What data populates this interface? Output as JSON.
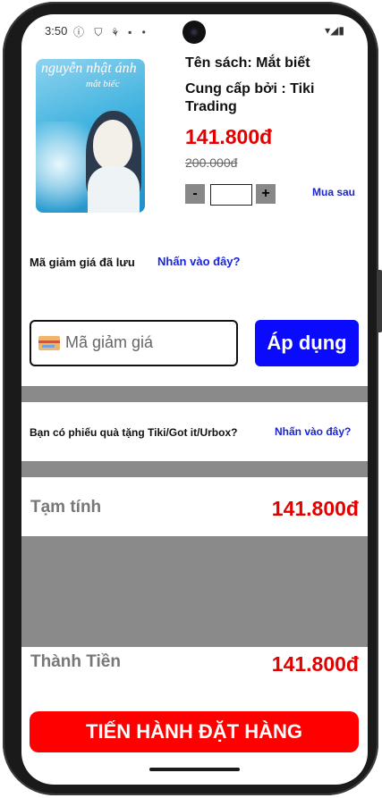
{
  "status_bar": {
    "time": "3:50",
    "left_icons": "ⓘ ⛉ ⚘ ▪ •",
    "right_icons": "▾◢▮"
  },
  "product": {
    "cover_author": "nguyễn nhật ánh",
    "cover_title": "mắt biếc",
    "name": "Tên sách: Mắt biết",
    "supplier": "Cung cấp bởi : Tiki Trading",
    "price": "141.800đ",
    "old_price": "200.000đ",
    "qty_minus": "-",
    "qty_plus": "+",
    "qty_value": "",
    "save_later": "Mua sau"
  },
  "coupon": {
    "saved_label": "Mã giảm giá đã lưu",
    "saved_link": "Nhấn vào đây?",
    "input_placeholder": "Mã giảm giá",
    "apply_label": "Áp dụng"
  },
  "gift": {
    "text": "Bạn có phiếu quà tặng Tiki/Got it/Urbox?",
    "link": "Nhấn vào đây?"
  },
  "summary": {
    "subtotal_label": "Tạm tính",
    "subtotal_value": "141.800đ",
    "total_label": "Thành Tiền",
    "total_value": "141.800đ"
  },
  "checkout": {
    "label": "TIẾN HÀNH ĐẶT HÀNG"
  },
  "colors": {
    "price": "#e50000",
    "link": "#1a25d6",
    "apply_button": "#0a0aff",
    "checkout_button": "#ff0000",
    "band": "#8a8a8a"
  }
}
